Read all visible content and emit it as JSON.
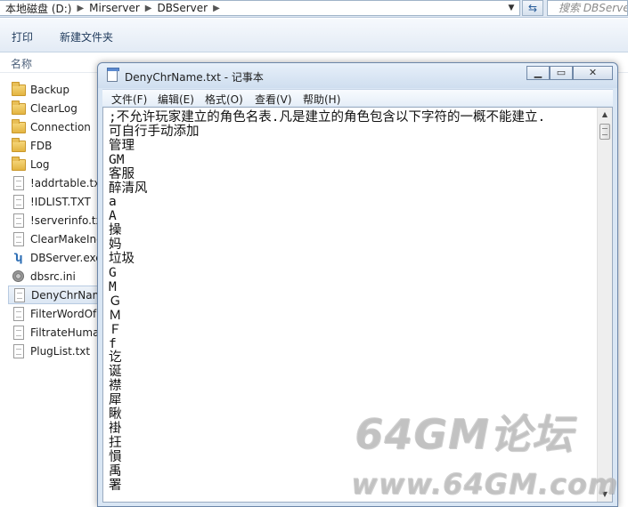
{
  "explorer": {
    "address": {
      "segments": [
        "本地磁盘 (D:)",
        "Mirserver",
        "DBServer"
      ]
    },
    "search_placeholder": "搜索 DBServer",
    "toolbar": {
      "print_label": "打印",
      "new_folder_label": "新建文件夹"
    },
    "columns": {
      "name": "名称"
    },
    "files": [
      {
        "name": "Backup",
        "type": "folder"
      },
      {
        "name": "ClearLog",
        "type": "folder"
      },
      {
        "name": "Connection",
        "type": "folder"
      },
      {
        "name": "FDB",
        "type": "folder"
      },
      {
        "name": "Log",
        "type": "folder"
      },
      {
        "name": "!addrtable.txt",
        "type": "text"
      },
      {
        "name": "!IDLIST.TXT",
        "type": "text"
      },
      {
        "name": "!serverinfo.txt",
        "type": "text"
      },
      {
        "name": "ClearMakeIndex.txt",
        "type": "text"
      },
      {
        "name": "DBServer.exe",
        "type": "exe"
      },
      {
        "name": "dbsrc.ini",
        "type": "ini"
      },
      {
        "name": "DenyChrName.txt",
        "type": "text",
        "selected": true
      },
      {
        "name": "FilterWordOfName.txt",
        "type": "text"
      },
      {
        "name": "FiltrateHumanName.txt",
        "type": "text"
      },
      {
        "name": "PlugList.txt",
        "type": "text"
      }
    ]
  },
  "notepad": {
    "title": "DenyChrName.txt - 记事本",
    "menu": {
      "file": "文件(F)",
      "edit": "编辑(E)",
      "format": "格式(O)",
      "view": "查看(V)",
      "help": "帮助(H)"
    },
    "lines": [
      ";不允许玩家建立的角色名表.凡是建立的角色包含以下字符的一概不能建立.",
      "可自行手动添加",
      "管理",
      "GM",
      "客服",
      "醉清风",
      "a",
      "A",
      "操",
      "妈",
      "垃圾",
      "G",
      "M",
      "Ｇ",
      "Ｍ",
      "Ｆ",
      "f",
      "讫",
      "诞",
      "襟",
      "犀",
      "瞅",
      "褂",
      "抂",
      "愪",
      "禹",
      "署"
    ]
  },
  "watermark": {
    "line1": "64GM论坛",
    "line2": "www.64GM.com"
  }
}
